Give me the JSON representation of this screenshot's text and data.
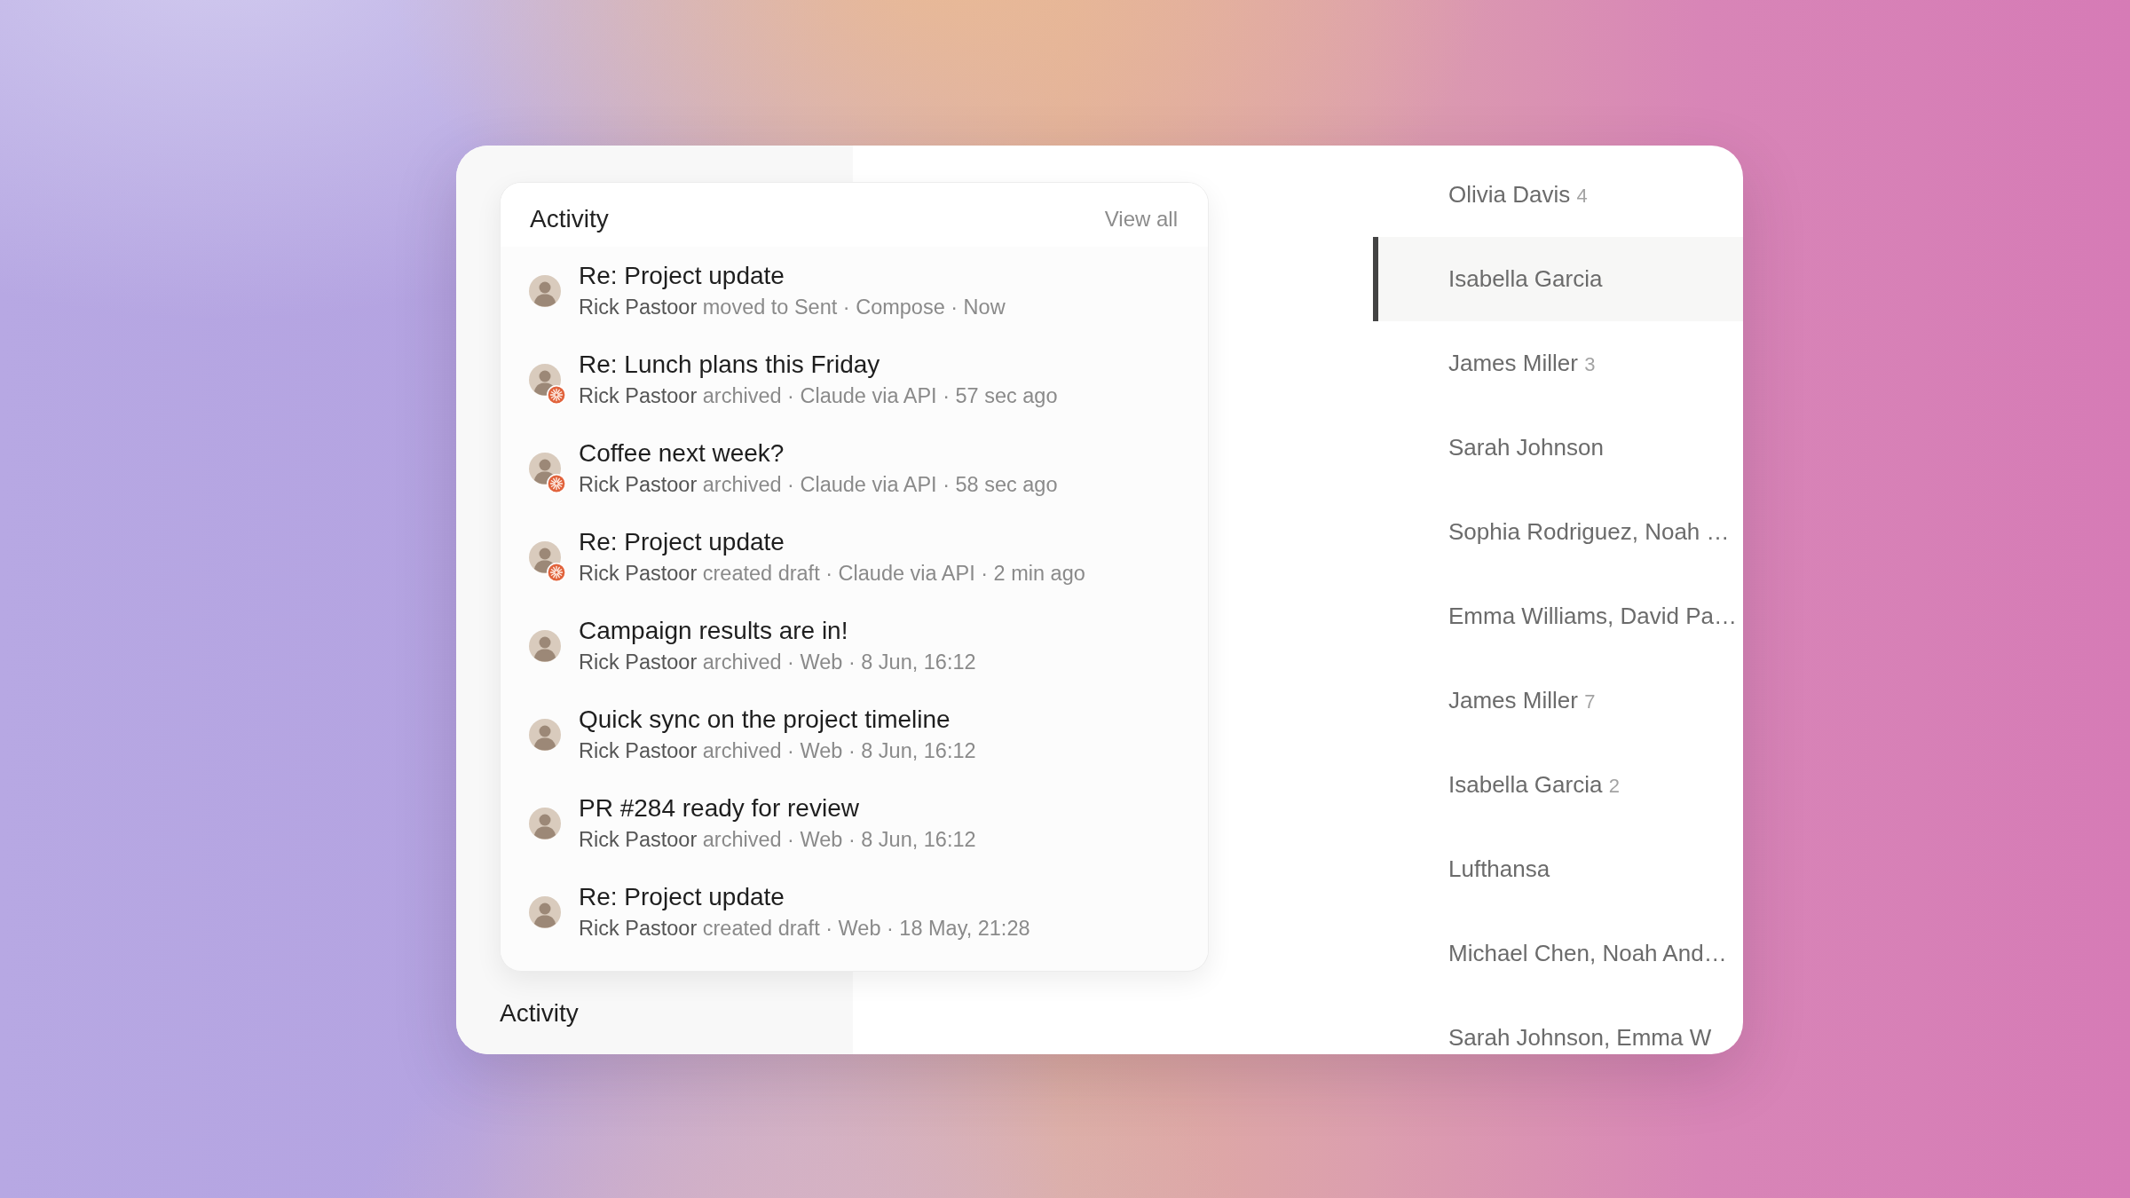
{
  "activity_card": {
    "title": "Activity",
    "view_all": "View all",
    "items": [
      {
        "title": "Re: Project update",
        "actor": "Rick Pastoor",
        "detail": "moved to Sent · Compose · Now",
        "agent_badge": false
      },
      {
        "title": "Re: Lunch plans this Friday",
        "actor": "Rick Pastoor",
        "detail": "archived · Claude via API · 57 sec ago",
        "agent_badge": true
      },
      {
        "title": "Coffee next week?",
        "actor": "Rick Pastoor",
        "detail": "archived · Claude via API · 58 sec ago",
        "agent_badge": true
      },
      {
        "title": "Re: Project update",
        "actor": "Rick Pastoor",
        "detail": "created draft · Claude via API · 2 min ago",
        "agent_badge": true
      },
      {
        "title": "Campaign results are in!",
        "actor": "Rick Pastoor",
        "detail": "archived · Web · 8 Jun, 16:12",
        "agent_badge": false
      },
      {
        "title": "Quick sync on the project timeline",
        "actor": "Rick Pastoor",
        "detail": "archived · Web · 8 Jun, 16:12",
        "agent_badge": false
      },
      {
        "title": "PR #284 ready for review",
        "actor": "Rick Pastoor",
        "detail": "archived · Web · 8 Jun, 16:12",
        "agent_badge": false
      },
      {
        "title": "Re: Project update",
        "actor": "Rick Pastoor",
        "detail": "created draft · Web · 18 May, 21:28",
        "agent_badge": false
      }
    ]
  },
  "section_heading": "Activity",
  "conversations": [
    {
      "name": "Olivia Davis",
      "count": "4",
      "selected": false
    },
    {
      "name": "Isabella Garcia",
      "selected": true
    },
    {
      "name": "James Miller",
      "count": "3",
      "selected": false
    },
    {
      "name": "Sarah Johnson",
      "selected": false
    },
    {
      "name": "Sophia Rodriguez, Noah …",
      "selected": false
    },
    {
      "name": "Emma Williams, David Pa…",
      "selected": false
    },
    {
      "name": "James Miller",
      "count": "7",
      "selected": false
    },
    {
      "name": "Isabella Garcia",
      "count": "2",
      "selected": false
    },
    {
      "name": "Lufthansa",
      "selected": false
    },
    {
      "name": "Michael Chen, Noah And…",
      "selected": false
    },
    {
      "name": "Sarah Johnson, Emma W",
      "selected": false
    }
  ]
}
